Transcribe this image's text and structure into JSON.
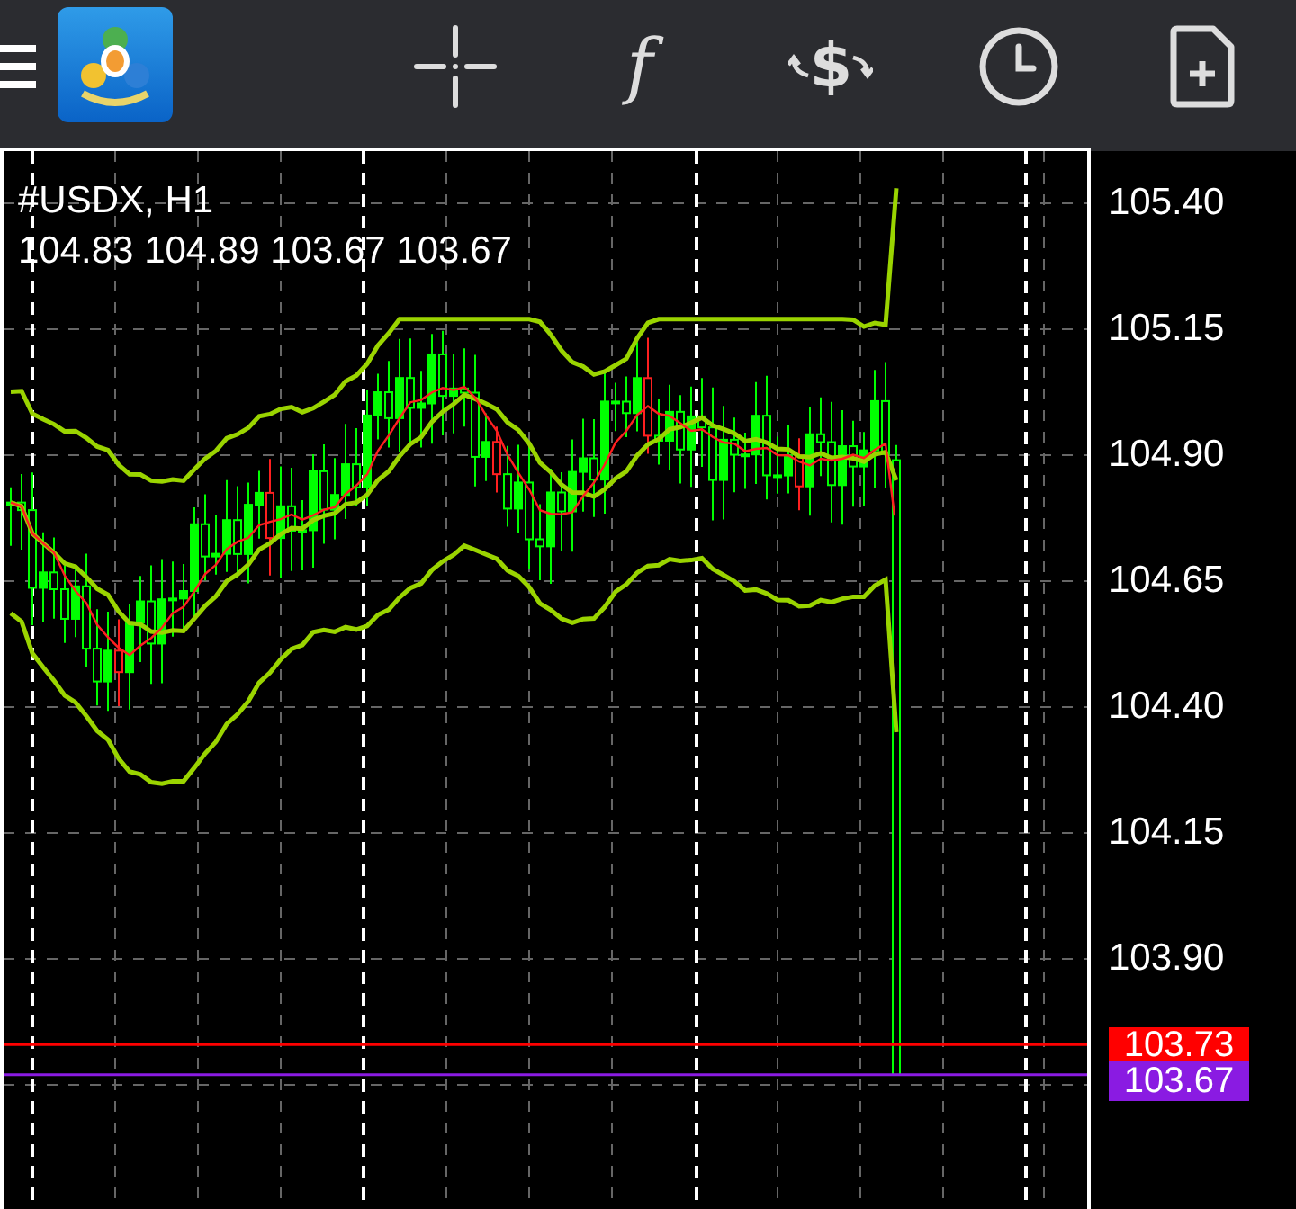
{
  "toolbar": {
    "indicators_glyph": "f",
    "trade_glyph": "$"
  },
  "chart": {
    "symbol": "#USDX, H1",
    "ohlc": "104.83 104.89 103.67 103.67",
    "price_axis": [
      "105.40",
      "105.15",
      "104.90",
      "104.65",
      "104.40",
      "104.15",
      "103.90"
    ],
    "price_markers": [
      {
        "label": "103.73",
        "color": "#ff0000"
      },
      {
        "label": "103.67",
        "color": "#8a1be2"
      }
    ]
  }
}
